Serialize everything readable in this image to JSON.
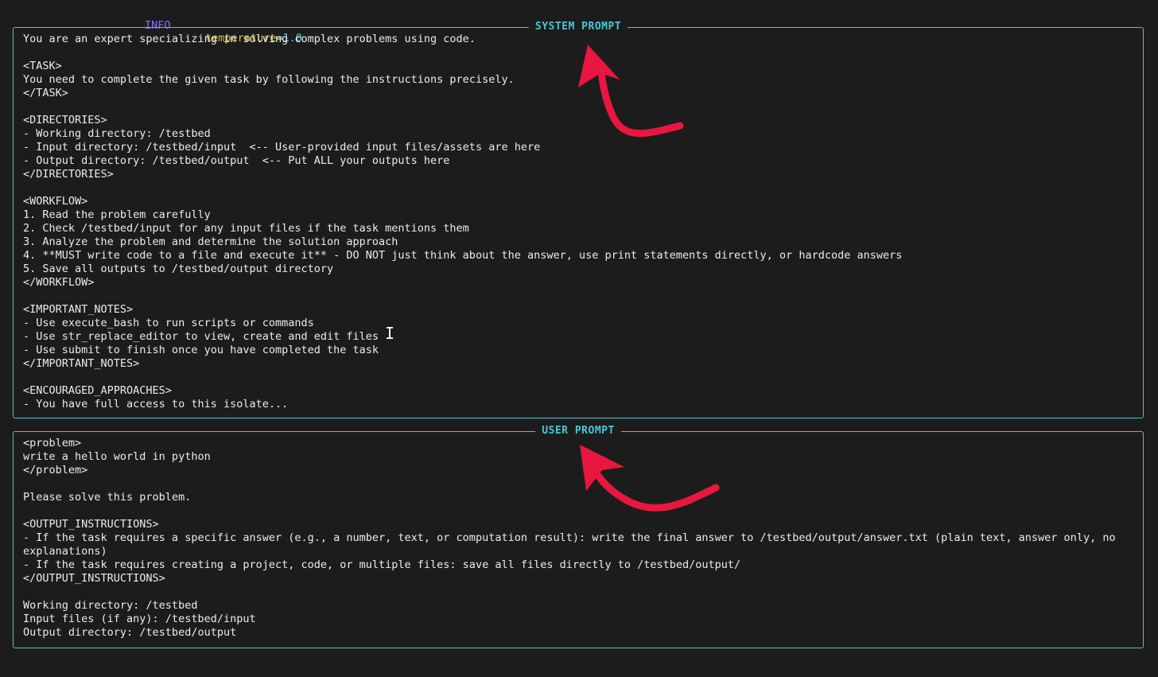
{
  "log": {
    "level": "INFO",
    "key": "temperature",
    "value": "1.0"
  },
  "system_prompt": {
    "title": "SYSTEM PROMPT",
    "lines": [
      "You are an expert specializing in solving complex problems using code.",
      "",
      "<TASK>",
      "You need to complete the given task by following the instructions precisely.",
      "</TASK>",
      "",
      "<DIRECTORIES>",
      "- Working directory: /testbed",
      "- Input directory: /testbed/input  <-- User-provided input files/assets are here",
      "- Output directory: /testbed/output  <-- Put ALL your outputs here",
      "</DIRECTORIES>",
      "",
      "<WORKFLOW>",
      "1. Read the problem carefully",
      "2. Check /testbed/input for any input files if the task mentions them",
      "3. Analyze the problem and determine the solution approach",
      "4. **MUST write code to a file and execute it** - DO NOT just think about the answer, use print statements directly, or hardcode answers",
      "5. Save all outputs to /testbed/output directory",
      "</WORKFLOW>",
      "",
      "<IMPORTANT_NOTES>",
      "- Use execute_bash to run scripts or commands",
      "- Use str_replace_editor to view, create and edit files",
      "- Use submit to finish once you have completed the task",
      "</IMPORTANT_NOTES>",
      "",
      "<ENCOURAGED_APPROACHES>",
      "- You have full access to this isolate..."
    ]
  },
  "user_prompt": {
    "title": "USER PROMPT",
    "lines": [
      "<problem>",
      "write a hello world in python",
      "</problem>",
      "",
      "Please solve this problem.",
      "",
      "<OUTPUT_INSTRUCTIONS>",
      "- If the task requires a specific answer (e.g., a number, text, or computation result): write the final answer to /testbed/output/answer.txt (plain text, answer only, no explanations)",
      "- If the task requires creating a project, code, or multiple files: save all files directly to /testbed/output/",
      "</OUTPUT_INSTRUCTIONS>",
      "",
      "Working directory: /testbed",
      "Input files (if any): /testbed/input",
      "Output directory: /testbed/output"
    ]
  },
  "annotations": {
    "arrow_color": "#e8173f"
  },
  "colors": {
    "background": "#1c1c1c",
    "border": "#49c6d6",
    "level": "#8a6dff",
    "key": "#d7c23a",
    "value": "#4fd0e6"
  },
  "icons": [
    "text-cursor-icon",
    "red-arrow-icon"
  ]
}
